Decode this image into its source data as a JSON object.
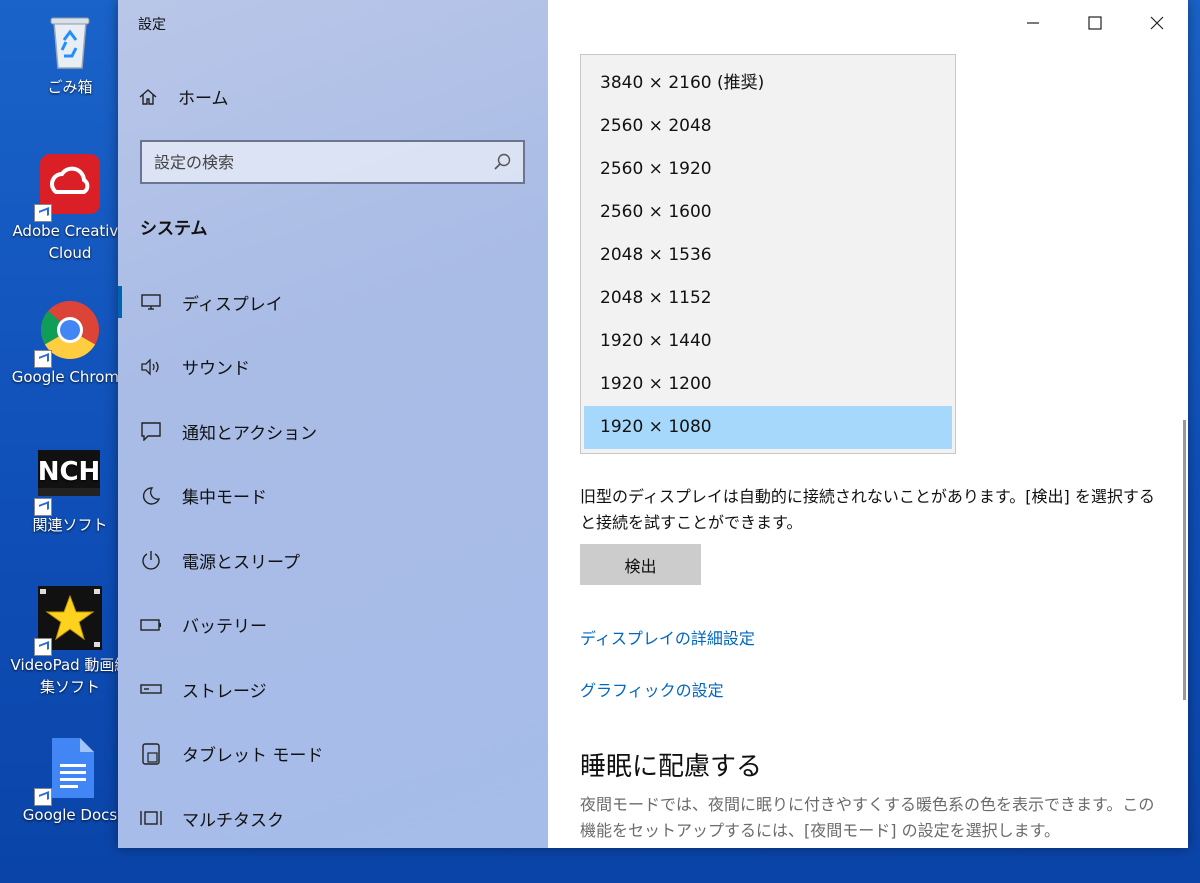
{
  "desktop": {
    "icons": [
      {
        "label": "ごみ箱"
      },
      {
        "label": "Adobe Creative Cloud"
      },
      {
        "label": "Google Chrome"
      },
      {
        "label": "関連ソフト"
      },
      {
        "label": "VideoPad 動画編集ソフト"
      },
      {
        "label": "Google Docs"
      }
    ]
  },
  "window": {
    "title": "設定",
    "home_label": "ホーム",
    "search_placeholder": "設定の検索",
    "section": "システム",
    "nav": [
      {
        "label": "ディスプレイ",
        "icon": "monitor-icon",
        "active": true
      },
      {
        "label": "サウンド",
        "icon": "speaker-icon"
      },
      {
        "label": "通知とアクション",
        "icon": "message-icon"
      },
      {
        "label": "集中モード",
        "icon": "moon-icon"
      },
      {
        "label": "電源とスリープ",
        "icon": "power-icon"
      },
      {
        "label": "バッテリー",
        "icon": "battery-icon"
      },
      {
        "label": "ストレージ",
        "icon": "storage-icon"
      },
      {
        "label": "タブレット モード",
        "icon": "tablet-icon"
      },
      {
        "label": "マルチタスク",
        "icon": "multitask-icon"
      }
    ]
  },
  "content": {
    "resolutions": [
      "3840 × 2160 (推奨)",
      "2560 × 2048",
      "2560 × 1920",
      "2560 × 1600",
      "2048 × 1536",
      "2048 × 1152",
      "1920 × 1440",
      "1920 × 1200",
      "1920 × 1080"
    ],
    "selected_resolution": "1920 × 1080",
    "detect_desc": "旧型のディスプレイは自動的に接続されないことがあります。[検出] を選択すると接続を試すことができます。",
    "detect_button": "検出",
    "link_advanced": "ディスプレイの詳細設定",
    "link_graphics": "グラフィックの設定",
    "sleep_heading": "睡眠に配慮する",
    "sleep_desc": "夜間モードでは、夜間に眠りに付きやすくする暖色系の色を表示できます。この機能をセットアップするには、[夜間モード] の設定を選択します。"
  },
  "colors": {
    "accent": "#0063b1",
    "link": "#0067c0",
    "selected": "#a6d8fb"
  }
}
